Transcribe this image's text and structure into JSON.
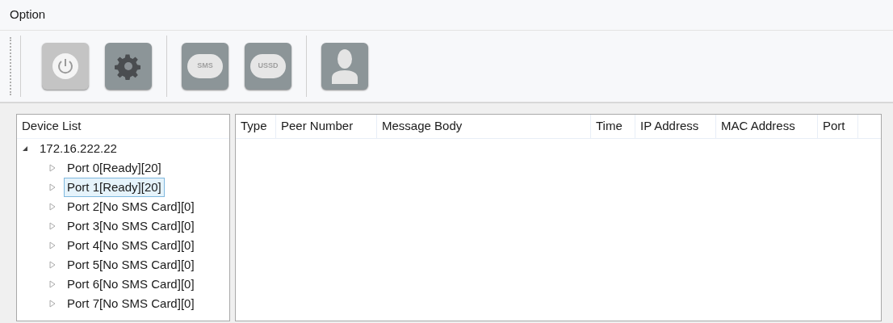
{
  "menu": [
    {
      "label": "Option"
    }
  ],
  "toolbar": [
    {
      "kind": "power",
      "disabled": true
    },
    {
      "kind": "settings",
      "disabled": false
    },
    {
      "kind": "separator"
    },
    {
      "kind": "sms",
      "label": "SMS",
      "disabled": false
    },
    {
      "kind": "ussd",
      "label": "USSD",
      "disabled": false
    },
    {
      "kind": "separator"
    },
    {
      "kind": "contact",
      "disabled": false
    }
  ],
  "device_list": {
    "title": "Device List",
    "tree": [
      {
        "label": "172.16.222.22",
        "expanded": true,
        "selected": false,
        "children": [
          {
            "label": "Port 0[Ready][20]",
            "expanded": false,
            "selected": false
          },
          {
            "label": "Port 1[Ready][20]",
            "expanded": false,
            "selected": true
          },
          {
            "label": "Port 2[No SMS Card][0]",
            "expanded": false,
            "selected": false
          },
          {
            "label": "Port 3[No SMS Card][0]",
            "expanded": false,
            "selected": false
          },
          {
            "label": "Port 4[No SMS Card][0]",
            "expanded": false,
            "selected": false
          },
          {
            "label": "Port 5[No SMS Card][0]",
            "expanded": false,
            "selected": false
          },
          {
            "label": "Port 6[No SMS Card][0]",
            "expanded": false,
            "selected": false
          },
          {
            "label": "Port 7[No SMS Card][0]",
            "expanded": false,
            "selected": false
          }
        ]
      }
    ]
  },
  "table": {
    "columns": [
      "Type",
      "Peer Number",
      "Message Body",
      "Time",
      "IP Address",
      "MAC Address",
      "Port"
    ]
  }
}
